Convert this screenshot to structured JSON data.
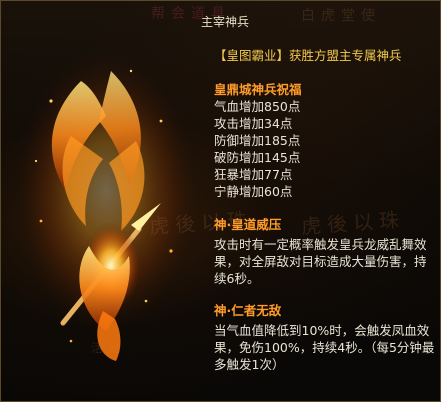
{
  "tooltip": {
    "title": "主宰神兵",
    "headline": "【皇图霸业】获胜方盟主专属神兵",
    "blessing_title": "皇鼎城神兵祝福",
    "stats": [
      "气血增加850点",
      "攻击增加34点",
      "防御增加185点",
      "破防增加145点",
      "狂暴增加77点",
      "宁静增加60点"
    ],
    "skills": [
      {
        "name": "神·皇道威压",
        "desc": "攻击时有一定概率触发皇兵龙威乱舞效果，对全屏敌对目标造成大量伤害，持续6秒。"
      },
      {
        "name": "神·仁者无敌",
        "desc": "当气血值降低到10%时，会触发凤血效果，免伤100%，持续4秒。（每5分钟最多触发1次）"
      }
    ]
  },
  "background": {
    "faint_text_top_left": "帮会道具",
    "faint_text_top_right": "白虎堂使",
    "faint_text_mid_left": "虎後以珠",
    "faint_text_mid_right": "虎後以珠",
    "faint_text_bottom": "活动"
  },
  "colors": {
    "headline": "#f2c94c",
    "section_title": "#ff9c2a",
    "body_text": "#e8e4d6",
    "title": "#e8e0c8"
  },
  "icons": {
    "weapon": "flaming-phoenix-spear-icon"
  }
}
